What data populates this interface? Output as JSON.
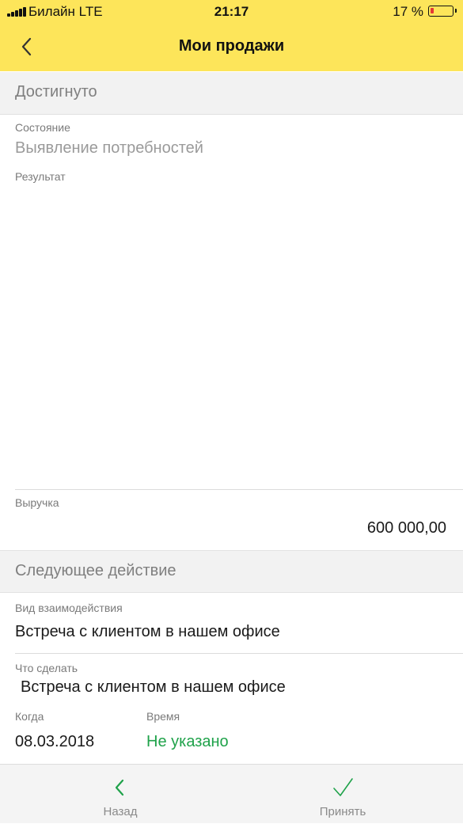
{
  "status_bar": {
    "carrier": "Билайн  LTE",
    "time": "21:17",
    "battery_percent": "17 %",
    "battery_level": 0.17,
    "battery_color": "#e53935"
  },
  "nav": {
    "back_icon": "chevron-left-icon",
    "title": "Мои продажи"
  },
  "achieved": {
    "header": "Достигнуто",
    "state_label": "Состояние",
    "state_value": "Выявление потребностей",
    "result_label": "Результат",
    "result_value": "",
    "revenue_label": "Выручка",
    "revenue_value": "600 000,00"
  },
  "next_action": {
    "header": "Следующее действие",
    "interaction_type_label": "Вид взаимодействия",
    "interaction_type_value": "Встреча с клиентом в нашем офисе",
    "todo_label": "Что сделать",
    "todo_value": "Встреча с клиентом в нашем офисе",
    "when_label": "Когда",
    "when_value": "08.03.2018",
    "time_label": "Время",
    "time_value": "Не указано",
    "time_value_color": "#1fa24a"
  },
  "toolbar": {
    "back_label": "Назад",
    "back_icon": "chevron-left-icon",
    "accept_label": "Принять",
    "accept_icon": "checkmark-icon",
    "accent_color": "#1fa24a"
  },
  "colors": {
    "header_yellow": "#fde55a",
    "section_bg": "#f2f2f2"
  }
}
